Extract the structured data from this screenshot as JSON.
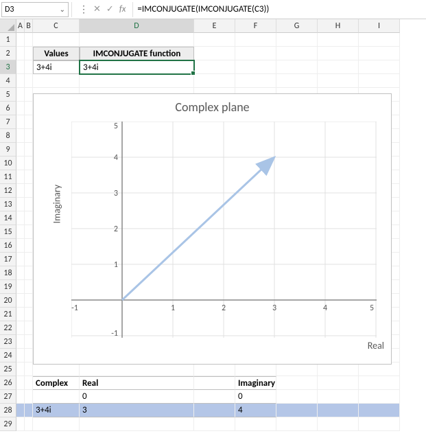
{
  "name_box": "D3",
  "formula": "=IMCONJUGATE(IMCONJUGATE(C3))",
  "columns": [
    "A",
    "B",
    "C",
    "D",
    "E",
    "F",
    "G",
    "H",
    "I"
  ],
  "rows": [
    "1",
    "2",
    "3",
    "4",
    "5",
    "6",
    "7",
    "8",
    "9",
    "10",
    "11",
    "12",
    "13",
    "14",
    "15",
    "16",
    "17",
    "18",
    "19",
    "20",
    "21",
    "22",
    "23",
    "24",
    "25",
    "26",
    "27",
    "28",
    "29"
  ],
  "sheet": {
    "C2": "Values",
    "D2": "IMCONJUGATE function",
    "C3": "3+4i",
    "D3": "3+4i",
    "C26": "Complex",
    "D26": "Real",
    "F26": "Imaginary",
    "D27": "0",
    "F27": "0",
    "C28": "3+4i",
    "D28": "3",
    "F28": "4"
  },
  "chart_data": {
    "type": "line",
    "title": "Complex plane",
    "xlabel": "Real",
    "ylabel": "Imaginary",
    "xlim": [
      -1,
      5
    ],
    "ylim": [
      -1,
      5
    ],
    "series": [
      {
        "name": "vector",
        "points": [
          [
            0,
            0
          ],
          [
            3,
            4
          ]
        ],
        "arrow_end": true
      }
    ],
    "gridlines": true
  }
}
